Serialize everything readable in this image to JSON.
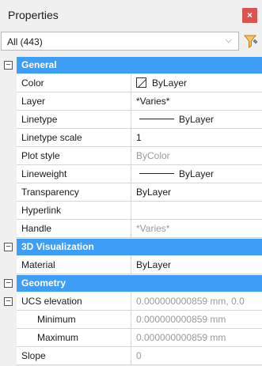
{
  "window": {
    "title": "Properties",
    "close_glyph": "×"
  },
  "selector": {
    "value": "All (443)",
    "chevron": "⌵"
  },
  "categories": {
    "general": "General",
    "visualization": "3D Visualization",
    "geometry": "Geometry"
  },
  "toggle_glyph": "⊟",
  "general": [
    {
      "name": "Color",
      "value": "ByLayer"
    },
    {
      "name": "Layer",
      "value": "*Varies*"
    },
    {
      "name": "Linetype",
      "value": "ByLayer"
    },
    {
      "name": "Linetype scale",
      "value": "1"
    },
    {
      "name": "Plot style",
      "value": "ByColor"
    },
    {
      "name": "Lineweight",
      "value": "ByLayer"
    },
    {
      "name": "Transparency",
      "value": "ByLayer"
    },
    {
      "name": "Hyperlink",
      "value": ""
    },
    {
      "name": "Handle",
      "value": "*Varies*"
    }
  ],
  "visualization": [
    {
      "name": "Material",
      "value": "ByLayer"
    }
  ],
  "geometry": [
    {
      "name": "UCS elevation",
      "value": "0.000000000859 mm, 0.0"
    },
    {
      "name": "Minimum",
      "value": "0.000000000859 mm"
    },
    {
      "name": "Maximum",
      "value": "0.000000000859 mm"
    },
    {
      "name": "Slope",
      "value": "0"
    }
  ],
  "colors": {
    "accent": "#3e9df5",
    "close": "#d9534f",
    "filter_icon": "#e8a33d"
  }
}
